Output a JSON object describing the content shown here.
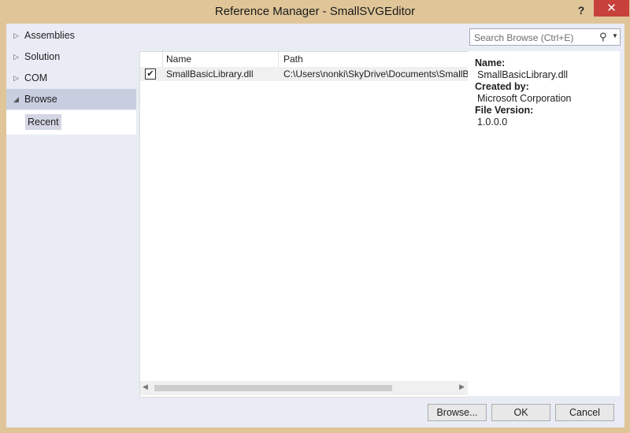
{
  "window": {
    "title": "Reference Manager - SmallSVGEditor",
    "help": "?",
    "close": "✕"
  },
  "nav": {
    "items": [
      {
        "label": "Assemblies",
        "arrow": "▷"
      },
      {
        "label": "Solution",
        "arrow": "▷"
      },
      {
        "label": "COM",
        "arrow": "▷"
      },
      {
        "label": "Browse",
        "arrow": "◢"
      }
    ],
    "sub_item": "Recent"
  },
  "search": {
    "placeholder": "Search Browse (Ctrl+E)"
  },
  "grid": {
    "columns": [
      "Name",
      "Path"
    ],
    "rows": [
      {
        "checked": "✔",
        "name": "SmallBasicLibrary.dll",
        "path": "C:\\Users\\nonki\\SkyDrive\\Documents\\SmallB"
      }
    ]
  },
  "details": {
    "name_label": "Name:",
    "name_value": "SmallBasicLibrary.dll",
    "created_label": "Created by:",
    "created_value": "Microsoft Corporation",
    "version_label": "File Version:",
    "version_value": "1.0.0.0"
  },
  "buttons": {
    "browse": "Browse...",
    "ok": "OK",
    "cancel": "Cancel"
  },
  "colors": {
    "titlebar": "#dfc598",
    "close": "#c7413a",
    "panel": "#e9ecf5",
    "selected": "#c8cde0"
  }
}
